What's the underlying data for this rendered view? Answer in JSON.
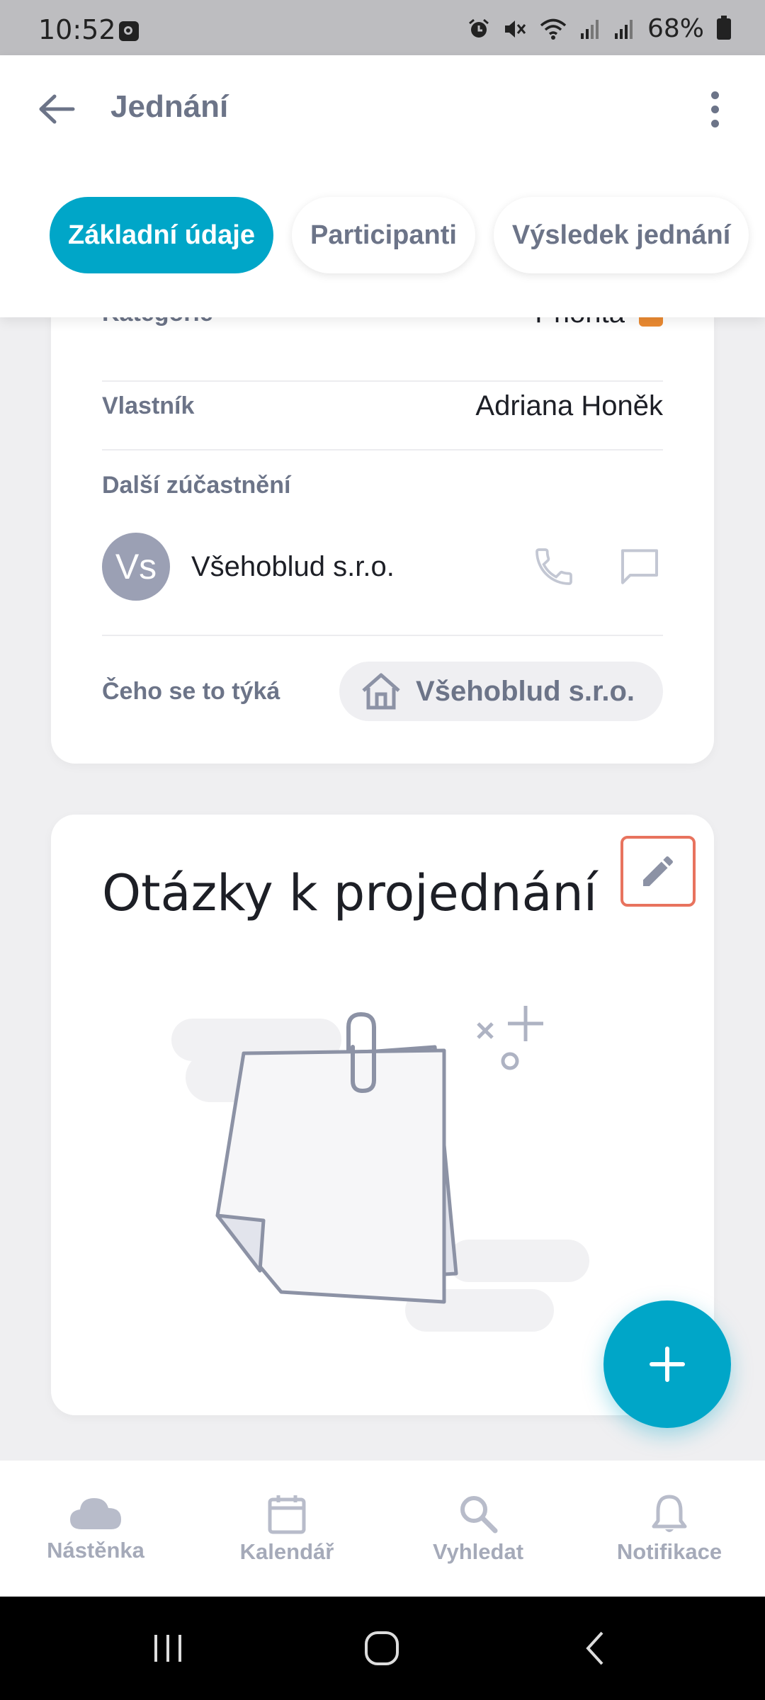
{
  "status_bar": {
    "time": "10:52",
    "battery": "68%"
  },
  "app_bar": {
    "title": "Jednání"
  },
  "tabs": [
    {
      "label": "Základní údaje",
      "active": true
    },
    {
      "label": "Participanti",
      "active": false
    },
    {
      "label": "Výsledek jednání",
      "active": false
    }
  ],
  "details": {
    "category_label": "Kategorie",
    "category_value": "Priorita",
    "category_color": "#ea8a32",
    "owner_label": "Vlastník",
    "owner_value": "Adriana Honěk",
    "others_label": "Další zúčastnění",
    "participant": {
      "initials": "Vs",
      "name": "Všehoblud s.r.o."
    },
    "relates_label": "Čeho se to týká",
    "relates_value": "Všehoblud s.r.o."
  },
  "questions": {
    "title": "Otázky k projednání"
  },
  "fab": {
    "icon": "plus-icon"
  },
  "bottom_nav": [
    {
      "label": "Nástěnka",
      "icon": "cloud-icon"
    },
    {
      "label": "Kalendář",
      "icon": "calendar-icon"
    },
    {
      "label": "Vyhledat",
      "icon": "search-icon"
    },
    {
      "label": "Notifikace",
      "icon": "bell-icon"
    }
  ],
  "colors": {
    "accent": "#00a6c8",
    "edit_border": "#e8735e",
    "muted_text": "#6c7488"
  }
}
